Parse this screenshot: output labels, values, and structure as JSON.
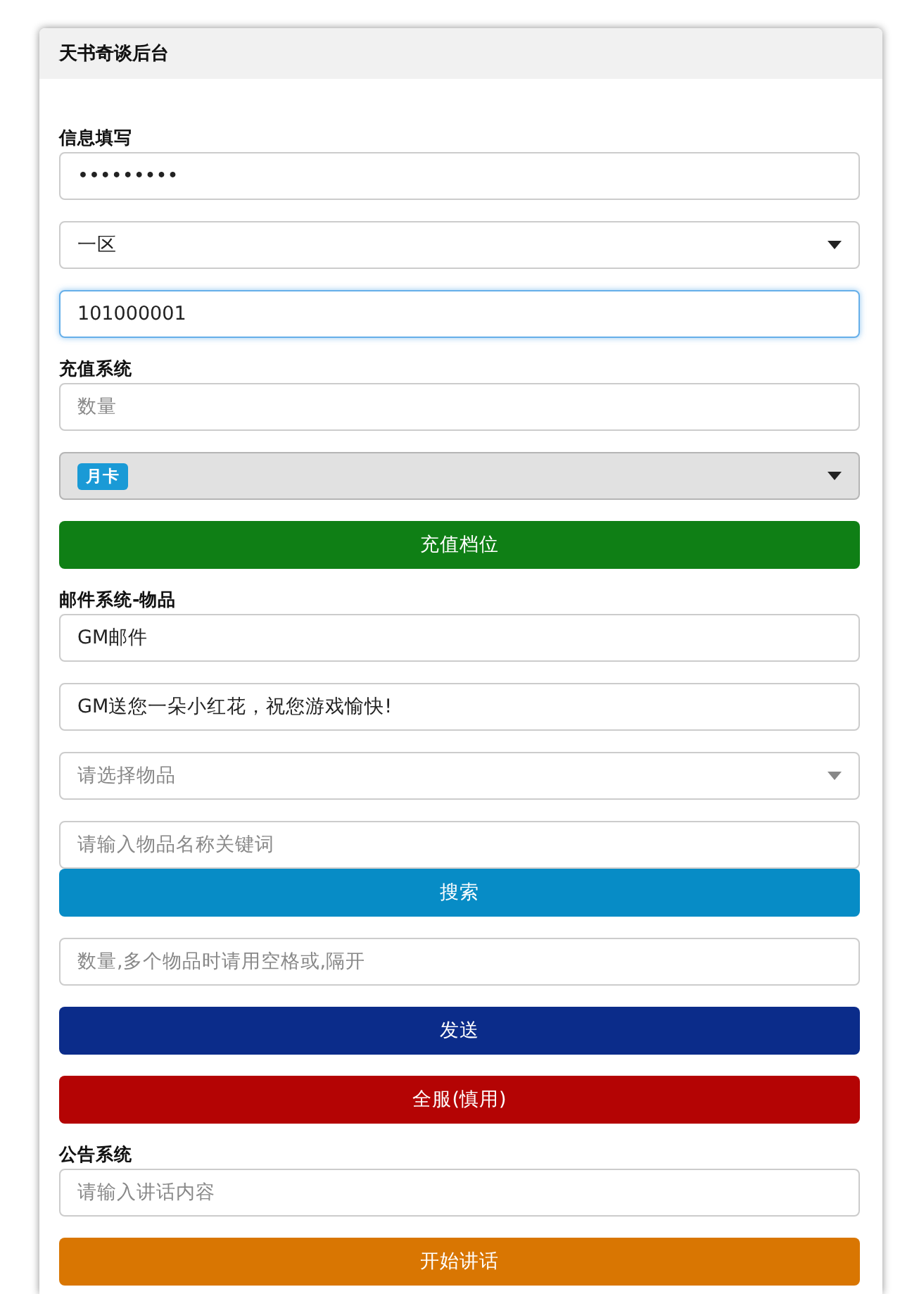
{
  "header": {
    "title": "天书奇谈后台"
  },
  "items": [
    {
      "kind": "label",
      "text": "信息填写"
    },
    {
      "kind": "password",
      "value": "•••••••••",
      "focused": false
    },
    {
      "kind": "select",
      "value": "一区"
    },
    {
      "kind": "input",
      "value": "101000001",
      "focused": true
    },
    {
      "kind": "label",
      "text": "充值系统"
    },
    {
      "kind": "input",
      "placeholder": "数量",
      "focused": false
    },
    {
      "kind": "tag_select",
      "tag": "月卡"
    },
    {
      "kind": "button",
      "text": "充值档位",
      "color": "#0f7f15"
    },
    {
      "kind": "label",
      "text": "邮件系统-物品"
    },
    {
      "kind": "input",
      "value": "GM邮件",
      "focused": false
    },
    {
      "kind": "input",
      "value": "GM送您一朵小红花，祝您游戏愉快!",
      "focused": false
    },
    {
      "kind": "select",
      "placeholder": "请选择物品"
    },
    {
      "kind": "input",
      "placeholder": "请输入物品名称关键词",
      "focused": false
    },
    {
      "kind": "attached_button",
      "text": "搜索",
      "color": "#078cc6"
    },
    {
      "kind": "input",
      "placeholder": "数量,多个物品时请用空格或,隔开",
      "focused": false
    },
    {
      "kind": "button",
      "text": "发送",
      "color": "#0b2c8a"
    },
    {
      "kind": "button",
      "text": "全服(慎用)",
      "color": "#b40404"
    },
    {
      "kind": "label",
      "text": "公告系统"
    },
    {
      "kind": "input",
      "placeholder": "请输入讲话内容",
      "focused": false
    },
    {
      "kind": "button",
      "text": "开始讲话",
      "color": "#d97602"
    }
  ]
}
